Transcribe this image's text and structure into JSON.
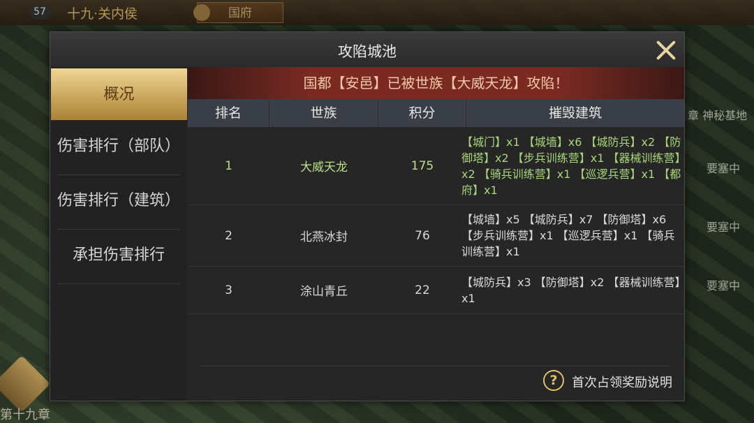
{
  "hud": {
    "level": "57",
    "chapter": "十九·关内侯",
    "capital_button": "国府",
    "right_labels": [
      "章 神秘基地",
      "要塞中",
      "要塞中",
      "要塞中"
    ],
    "bottom_left": "第十九章"
  },
  "dialog": {
    "title": "攻陷城池",
    "close_icon": "close-icon"
  },
  "menu": {
    "items": [
      {
        "label": "概况",
        "active": true
      },
      {
        "label": "伤害排行（部队）",
        "active": false
      },
      {
        "label": "伤害排行（建筑）",
        "active": false
      },
      {
        "label": "承担伤害排行",
        "active": false
      }
    ]
  },
  "banner": "国都【安邑】已被世族【大威天龙】攻陷！",
  "table": {
    "headers": [
      "排名",
      "世族",
      "积分",
      "摧毁建筑"
    ],
    "rows": [
      {
        "rank": "1",
        "clan": "大威天龙",
        "score": "175",
        "buildings": "【城门】x1 【城墙】x6 【城防兵】x2 【防御塔】x2 【步兵训练营】x1 【器械训练营】x2 【骑兵训练营】x1 【巡逻兵营】x1 【都府】x1",
        "highlight": true
      },
      {
        "rank": "2",
        "clan": "北燕冰封",
        "score": "76",
        "buildings": "【城墙】x5 【城防兵】x7 【防御塔】x6 【步兵训练营】x1 【巡逻兵营】x1 【骑兵训练营】x1",
        "highlight": false
      },
      {
        "rank": "3",
        "clan": "涂山青丘",
        "score": "22",
        "buildings": "【城防兵】x3 【防御塔】x2 【器械训练营】x1",
        "highlight": false
      }
    ]
  },
  "footer": {
    "help_text": "首次占领奖励说明"
  },
  "colors": {
    "accent_gold": "#e2c06a",
    "banner_red": "#7a2a22",
    "highlight_green": "#a8d878"
  }
}
